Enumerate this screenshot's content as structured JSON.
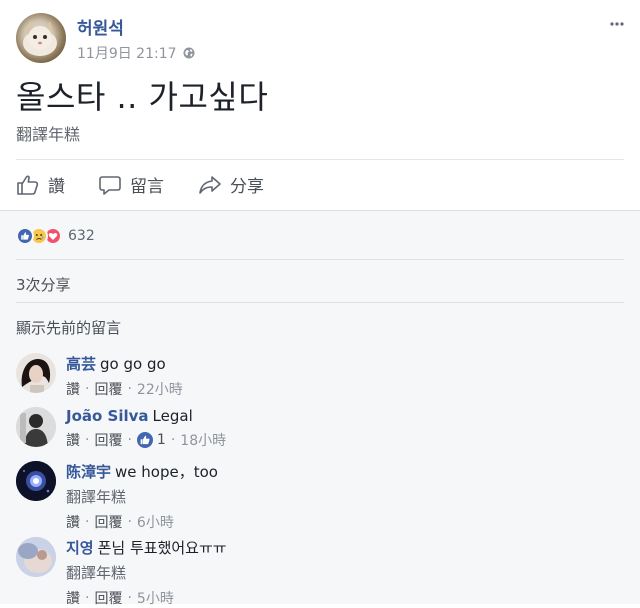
{
  "post": {
    "author": "허원석",
    "timestamp": "11月9日 21:17",
    "text": "올스타 .. 가고싶다",
    "translate_label": "翻譯年糕"
  },
  "actions": {
    "like": "讚",
    "comment": "留言",
    "share": "分享"
  },
  "reactions": {
    "icons": [
      "like-icon",
      "sad-icon",
      "love-icon"
    ],
    "count": "632"
  },
  "shares_text": "3次分享",
  "previous_comments": "顯示先前的留言",
  "comments": [
    {
      "name": "高芸",
      "text": "go go go",
      "translate": "",
      "like": "讚",
      "reply": "回覆",
      "likes": "",
      "time": "22小時"
    },
    {
      "name": "João Silva",
      "text": "Legal",
      "translate": "",
      "like": "讚",
      "reply": "回覆",
      "likes": "1",
      "time": "18小時"
    },
    {
      "name": "陈漳宇",
      "text": "we hope，too",
      "translate": "翻譯年糕",
      "like": "讚",
      "reply": "回覆",
      "likes": "",
      "time": "6小時"
    },
    {
      "name": "지영",
      "text": "폰님 투표했어요ㅠㅠ",
      "translate": "翻譯年糕",
      "like": "讚",
      "reply": "回覆",
      "likes": "",
      "time": "5小時"
    }
  ],
  "colors": {
    "link": "#365899",
    "like_blue": "#4267b2",
    "love_red": "#f25268",
    "sad_yellow": "#f7c84b",
    "muted": "#90949c"
  }
}
